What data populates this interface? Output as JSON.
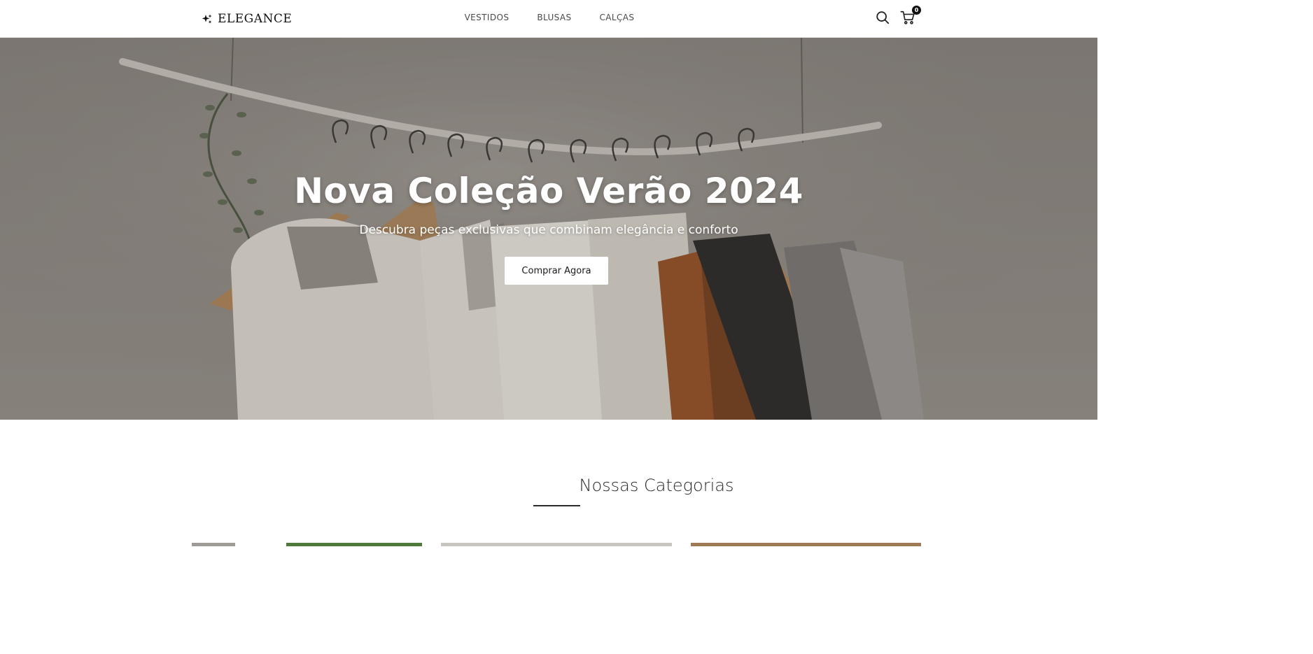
{
  "header": {
    "logo_text": "ELEGANCE",
    "logo_icon": "sparkles-icon",
    "nav": [
      {
        "label": "VESTIDOS"
      },
      {
        "label": "BLUSAS"
      },
      {
        "label": "CALÇAS"
      }
    ],
    "search_icon": "search-icon",
    "cart_icon": "cart-icon",
    "cart_count": "0"
  },
  "hero": {
    "title": "Nova Coleção Verão 2024",
    "subtitle": "Descubra peças exclusivas que combinam elegância e conforto",
    "cta_label": "Comprar Agora"
  },
  "categories": {
    "title": "Nossas Categorias"
  },
  "colors": {
    "text_dark": "#1f1f1f",
    "hero_overlay": "#8f8b86",
    "button_bg": "#ffffff",
    "badge_bg": "#111111"
  }
}
